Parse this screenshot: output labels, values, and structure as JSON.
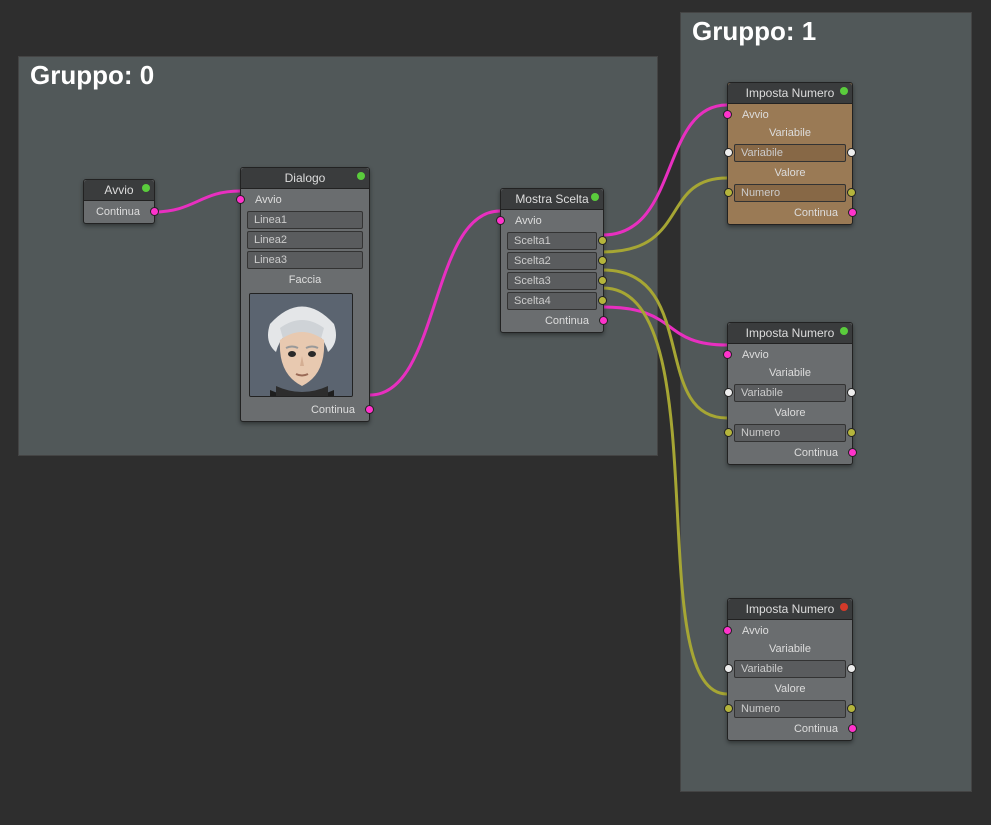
{
  "groups": {
    "g0": {
      "label": "Gruppo: 0"
    },
    "g1": {
      "label": "Gruppo: 1"
    }
  },
  "nodes": {
    "avvio": {
      "title": "Avvio",
      "continua": "Continua"
    },
    "dialogo": {
      "title": "Dialogo",
      "avvio": "Avvio",
      "linea1": "Linea1",
      "linea2": "Linea2",
      "linea3": "Linea3",
      "faccia": "Faccia",
      "continua": "Continua"
    },
    "scelta": {
      "title": "Mostra Scelta",
      "avvio": "Avvio",
      "s1": "Scelta1",
      "s2": "Scelta2",
      "s3": "Scelta3",
      "s4": "Scelta4",
      "continua": "Continua"
    },
    "imposta": {
      "title": "Imposta Numero",
      "avvio": "Avvio",
      "variabile_hdr": "Variabile",
      "variabile": "Variabile",
      "valore_hdr": "Valore",
      "numero": "Numero",
      "continua": "Continua"
    }
  }
}
